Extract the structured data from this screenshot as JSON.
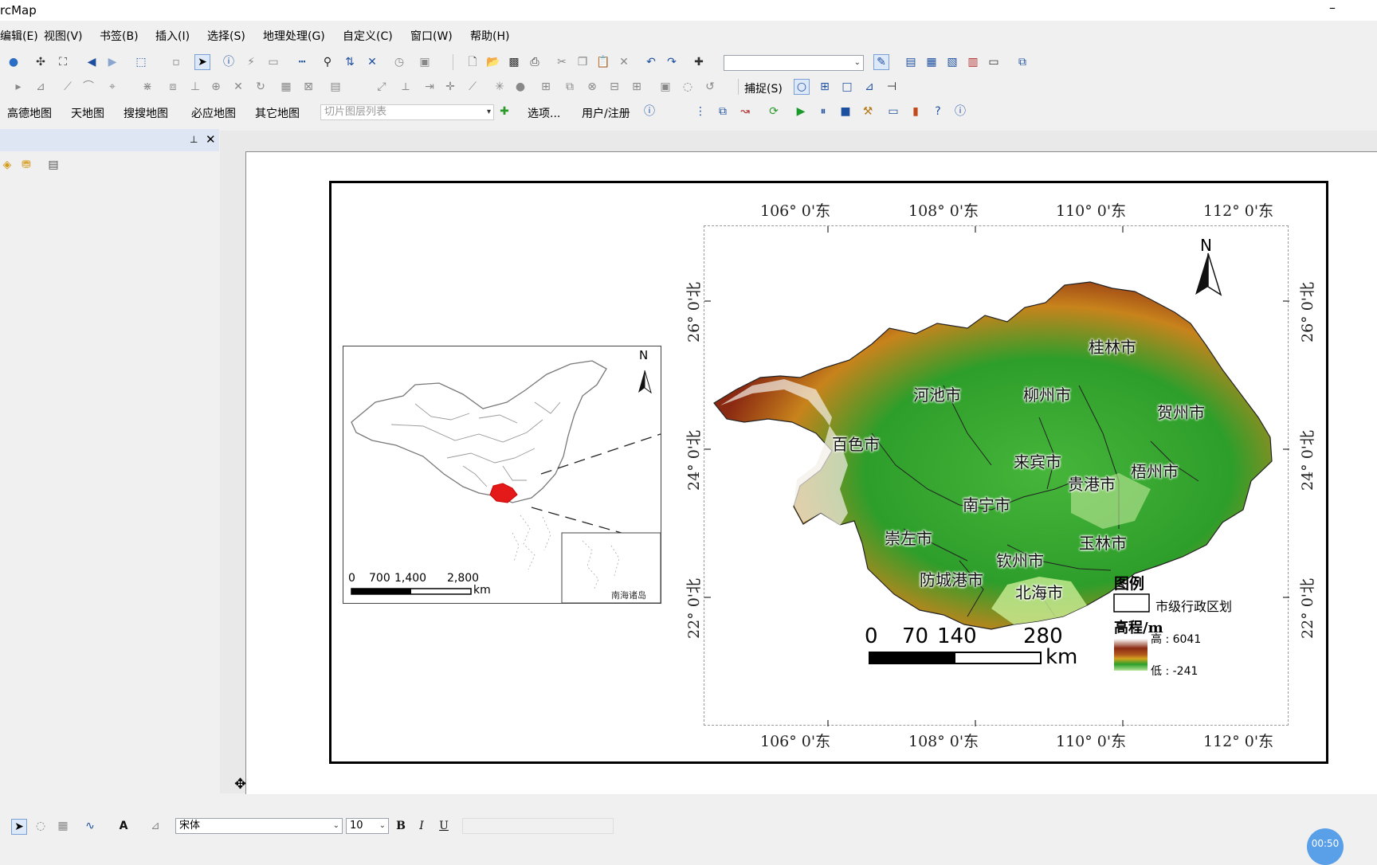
{
  "app": {
    "title": "rcMap"
  },
  "menu": [
    "编辑(E)",
    "视图(V)",
    "书签(B)",
    "插入(I)",
    "选择(S)",
    "地理处理(G)",
    "自定义(C)",
    "窗口(W)",
    "帮助(H)"
  ],
  "toolbar3": {
    "basemaps": [
      "高德地图",
      "天地图",
      "搜搜地图",
      "必应地图",
      "其它地图"
    ],
    "tile_placeholder": "切片图层列表",
    "options_label": "选项...",
    "user_label": "用户/注册"
  },
  "snap_label": "捕捉(S)",
  "map": {
    "top_lon_labels": [
      "106° 0'东",
      "108° 0'东",
      "110° 0'东",
      "112° 0'东"
    ],
    "bottom_lon_labels": [
      "106° 0'东",
      "108° 0'东",
      "110° 0'东",
      "112° 0'东"
    ],
    "left_lat_labels": [
      "26° 0'北",
      "24° 0'北",
      "22° 0'北"
    ],
    "right_lat_labels": [
      "26° 0'北",
      "24° 0'北",
      "22° 0'北"
    ],
    "north_label": "N",
    "cities": [
      "桂林市",
      "河池市",
      "柳州市",
      "贺州市",
      "百色市",
      "来宾市",
      "梧州市",
      "贵港市",
      "南宁市",
      "崇左市",
      "玉林市",
      "钦州市",
      "防城港市",
      "北海市"
    ],
    "scale_ticks": [
      "0",
      "70",
      "140",
      "280"
    ],
    "scale_unit": "km"
  },
  "inset": {
    "north_label": "N",
    "scale_ticks": [
      "0",
      "700",
      "1,400",
      "2,800"
    ],
    "scale_unit": "km",
    "sub_label": "南海诸岛"
  },
  "legend": {
    "title": "图例",
    "boundary_label": "市级行政区划",
    "elev_title": "高程/m",
    "high_label": "高 : 6041",
    "low_label": "低 : -241",
    "colors": [
      "#8b2a12",
      "#b25a1d",
      "#d4a21e",
      "#2aa02a",
      "#b6e39a"
    ]
  },
  "draw_toolbar": {
    "font": "宋体",
    "size": "10",
    "bold": "B",
    "italic": "I",
    "underline": "U"
  },
  "status": {
    "timer": "00:50"
  }
}
